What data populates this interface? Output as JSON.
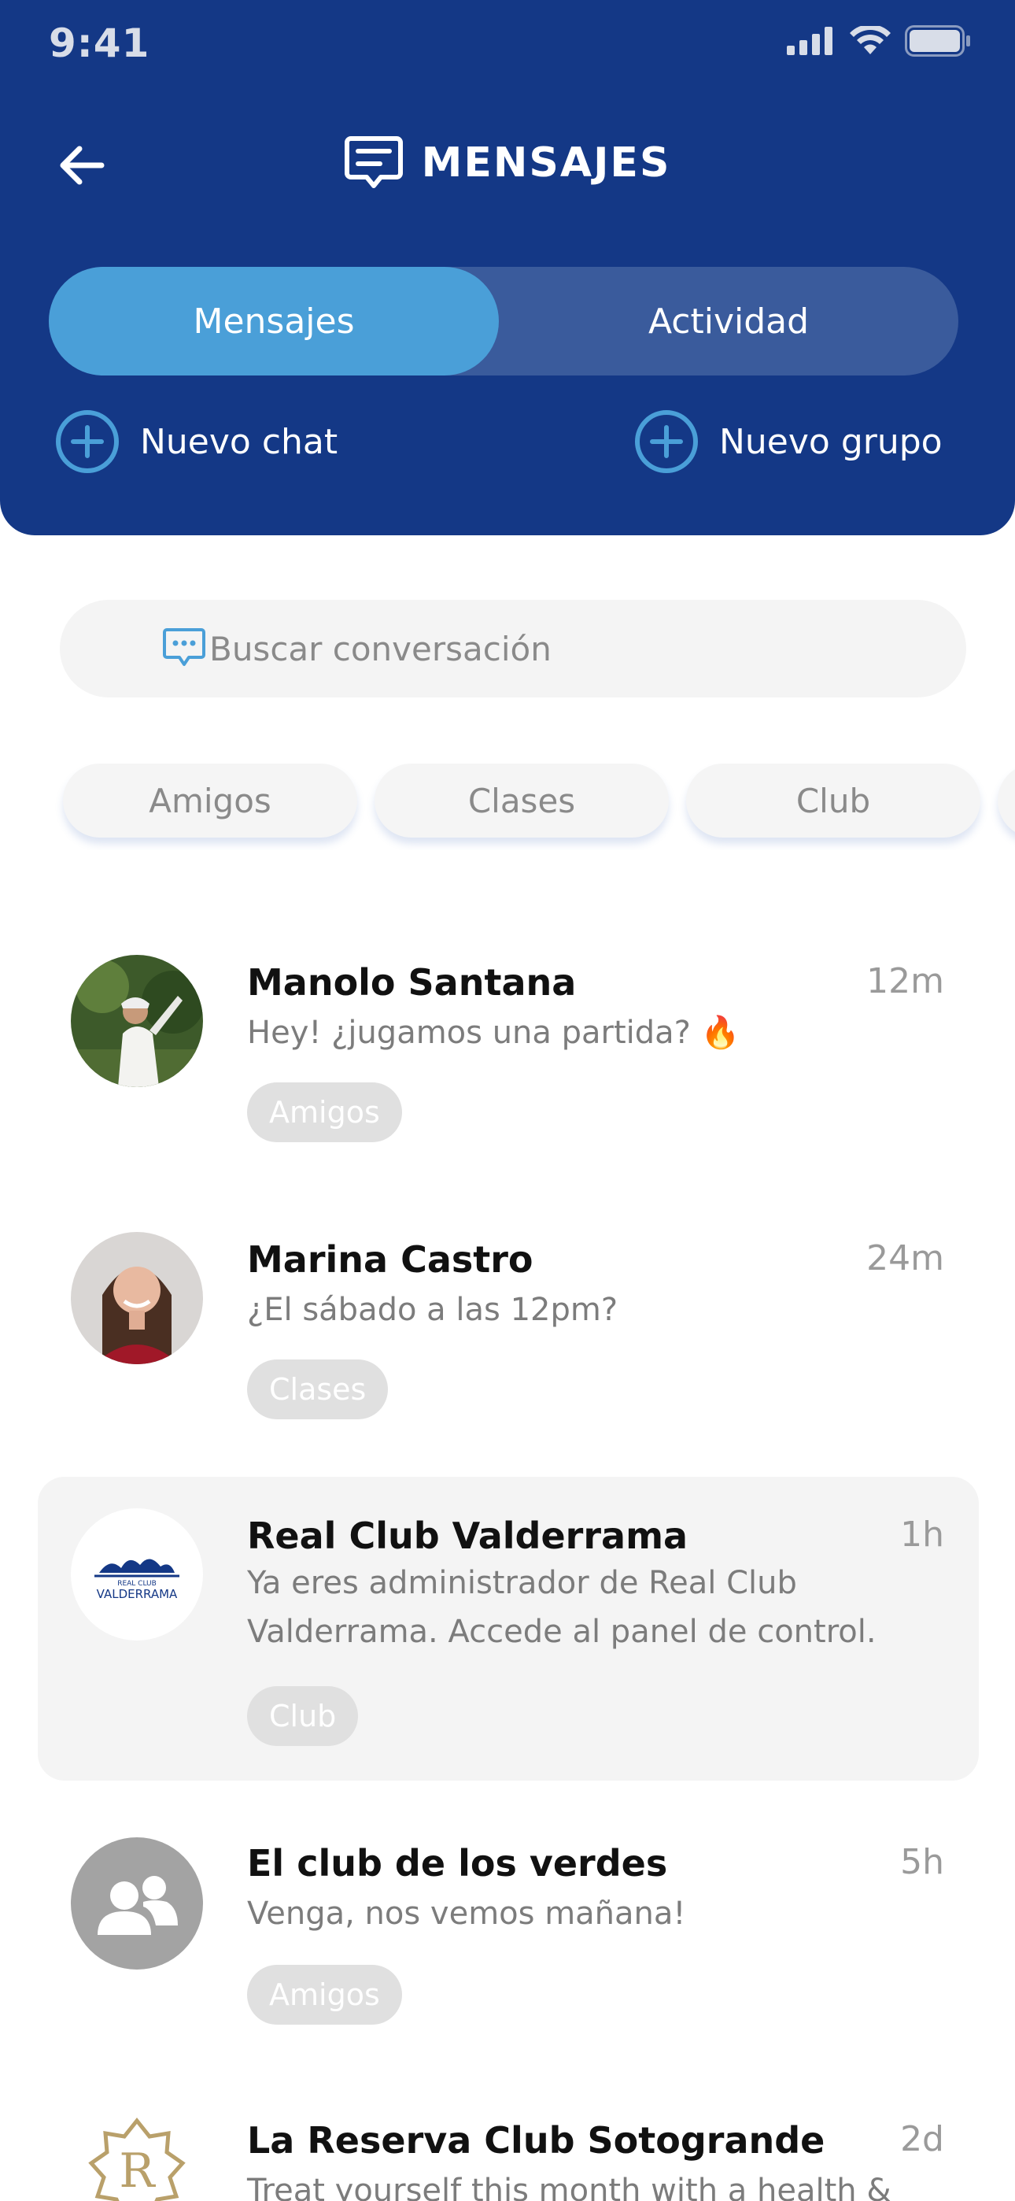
{
  "status_bar": {
    "time": "9:41"
  },
  "header": {
    "title": "MENSAJES",
    "tabs": [
      {
        "label": "Mensajes",
        "active": true
      },
      {
        "label": "Actividad",
        "active": false
      }
    ],
    "actions": {
      "new_chat": "Nuevo chat",
      "new_group": "Nuevo grupo"
    }
  },
  "search": {
    "placeholder": "Buscar conversación"
  },
  "filters": [
    "Amigos",
    "Clases",
    "Club"
  ],
  "conversations": [
    {
      "name": "Manolo Santana",
      "time": "12m",
      "preview": "Hey! ¿jugamos una partida? 🔥",
      "tag": "Amigos",
      "avatar": "golfer-photo"
    },
    {
      "name": "Marina Castro",
      "time": "24m",
      "preview": "¿El sábado a las 12pm?",
      "tag": "Clases",
      "avatar": "woman-photo"
    },
    {
      "name": "Real Club Valderrama",
      "time": "1h",
      "preview": "Ya eres administrador de Real Club Valderrama. Accede al panel de control.",
      "tag": "Club",
      "avatar": "valderrama-logo",
      "logo_text": "VALDERRAMA",
      "logo_small": "REAL CLUB"
    },
    {
      "name": "El club de los verdes",
      "time": "5h",
      "preview": "Venga, nos vemos mañana!",
      "tag": "Amigos",
      "avatar": "group-icon"
    },
    {
      "name": "La Reserva Club Sotogrande",
      "time": "2d",
      "preview": "Treat yourself this month with a health &",
      "tag": "",
      "avatar": "la-reserva-logo",
      "logo_text": "R"
    }
  ],
  "colors": {
    "header": "#143886",
    "accent": "#4a9fd8",
    "segment": "#3a5b9c"
  }
}
